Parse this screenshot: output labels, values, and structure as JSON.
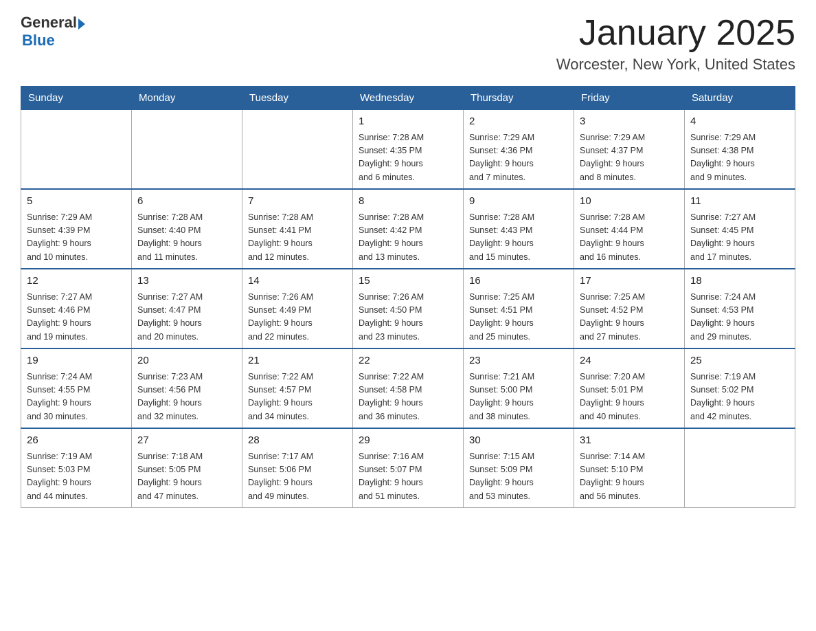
{
  "header": {
    "logo_general": "General",
    "logo_blue": "Blue",
    "month_title": "January 2025",
    "location": "Worcester, New York, United States"
  },
  "days_of_week": [
    "Sunday",
    "Monday",
    "Tuesday",
    "Wednesday",
    "Thursday",
    "Friday",
    "Saturday"
  ],
  "weeks": [
    [
      {
        "day": "",
        "info": ""
      },
      {
        "day": "",
        "info": ""
      },
      {
        "day": "",
        "info": ""
      },
      {
        "day": "1",
        "info": "Sunrise: 7:28 AM\nSunset: 4:35 PM\nDaylight: 9 hours\nand 6 minutes."
      },
      {
        "day": "2",
        "info": "Sunrise: 7:29 AM\nSunset: 4:36 PM\nDaylight: 9 hours\nand 7 minutes."
      },
      {
        "day": "3",
        "info": "Sunrise: 7:29 AM\nSunset: 4:37 PM\nDaylight: 9 hours\nand 8 minutes."
      },
      {
        "day": "4",
        "info": "Sunrise: 7:29 AM\nSunset: 4:38 PM\nDaylight: 9 hours\nand 9 minutes."
      }
    ],
    [
      {
        "day": "5",
        "info": "Sunrise: 7:29 AM\nSunset: 4:39 PM\nDaylight: 9 hours\nand 10 minutes."
      },
      {
        "day": "6",
        "info": "Sunrise: 7:28 AM\nSunset: 4:40 PM\nDaylight: 9 hours\nand 11 minutes."
      },
      {
        "day": "7",
        "info": "Sunrise: 7:28 AM\nSunset: 4:41 PM\nDaylight: 9 hours\nand 12 minutes."
      },
      {
        "day": "8",
        "info": "Sunrise: 7:28 AM\nSunset: 4:42 PM\nDaylight: 9 hours\nand 13 minutes."
      },
      {
        "day": "9",
        "info": "Sunrise: 7:28 AM\nSunset: 4:43 PM\nDaylight: 9 hours\nand 15 minutes."
      },
      {
        "day": "10",
        "info": "Sunrise: 7:28 AM\nSunset: 4:44 PM\nDaylight: 9 hours\nand 16 minutes."
      },
      {
        "day": "11",
        "info": "Sunrise: 7:27 AM\nSunset: 4:45 PM\nDaylight: 9 hours\nand 17 minutes."
      }
    ],
    [
      {
        "day": "12",
        "info": "Sunrise: 7:27 AM\nSunset: 4:46 PM\nDaylight: 9 hours\nand 19 minutes."
      },
      {
        "day": "13",
        "info": "Sunrise: 7:27 AM\nSunset: 4:47 PM\nDaylight: 9 hours\nand 20 minutes."
      },
      {
        "day": "14",
        "info": "Sunrise: 7:26 AM\nSunset: 4:49 PM\nDaylight: 9 hours\nand 22 minutes."
      },
      {
        "day": "15",
        "info": "Sunrise: 7:26 AM\nSunset: 4:50 PM\nDaylight: 9 hours\nand 23 minutes."
      },
      {
        "day": "16",
        "info": "Sunrise: 7:25 AM\nSunset: 4:51 PM\nDaylight: 9 hours\nand 25 minutes."
      },
      {
        "day": "17",
        "info": "Sunrise: 7:25 AM\nSunset: 4:52 PM\nDaylight: 9 hours\nand 27 minutes."
      },
      {
        "day": "18",
        "info": "Sunrise: 7:24 AM\nSunset: 4:53 PM\nDaylight: 9 hours\nand 29 minutes."
      }
    ],
    [
      {
        "day": "19",
        "info": "Sunrise: 7:24 AM\nSunset: 4:55 PM\nDaylight: 9 hours\nand 30 minutes."
      },
      {
        "day": "20",
        "info": "Sunrise: 7:23 AM\nSunset: 4:56 PM\nDaylight: 9 hours\nand 32 minutes."
      },
      {
        "day": "21",
        "info": "Sunrise: 7:22 AM\nSunset: 4:57 PM\nDaylight: 9 hours\nand 34 minutes."
      },
      {
        "day": "22",
        "info": "Sunrise: 7:22 AM\nSunset: 4:58 PM\nDaylight: 9 hours\nand 36 minutes."
      },
      {
        "day": "23",
        "info": "Sunrise: 7:21 AM\nSunset: 5:00 PM\nDaylight: 9 hours\nand 38 minutes."
      },
      {
        "day": "24",
        "info": "Sunrise: 7:20 AM\nSunset: 5:01 PM\nDaylight: 9 hours\nand 40 minutes."
      },
      {
        "day": "25",
        "info": "Sunrise: 7:19 AM\nSunset: 5:02 PM\nDaylight: 9 hours\nand 42 minutes."
      }
    ],
    [
      {
        "day": "26",
        "info": "Sunrise: 7:19 AM\nSunset: 5:03 PM\nDaylight: 9 hours\nand 44 minutes."
      },
      {
        "day": "27",
        "info": "Sunrise: 7:18 AM\nSunset: 5:05 PM\nDaylight: 9 hours\nand 47 minutes."
      },
      {
        "day": "28",
        "info": "Sunrise: 7:17 AM\nSunset: 5:06 PM\nDaylight: 9 hours\nand 49 minutes."
      },
      {
        "day": "29",
        "info": "Sunrise: 7:16 AM\nSunset: 5:07 PM\nDaylight: 9 hours\nand 51 minutes."
      },
      {
        "day": "30",
        "info": "Sunrise: 7:15 AM\nSunset: 5:09 PM\nDaylight: 9 hours\nand 53 minutes."
      },
      {
        "day": "31",
        "info": "Sunrise: 7:14 AM\nSunset: 5:10 PM\nDaylight: 9 hours\nand 56 minutes."
      },
      {
        "day": "",
        "info": ""
      }
    ]
  ]
}
